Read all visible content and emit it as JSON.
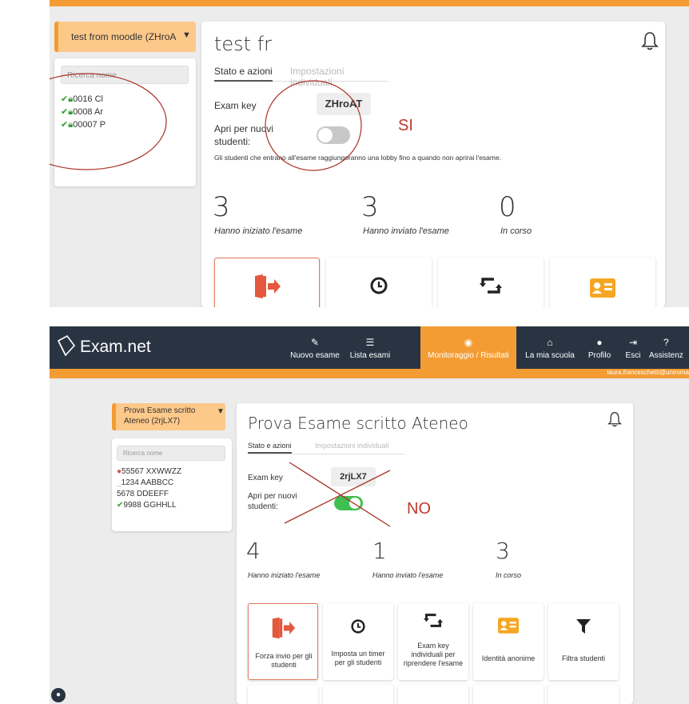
{
  "top": {
    "exam_dropdown": "test from moodle (ZHroA",
    "search_placeholder": "Ricerca nome",
    "students": [
      {
        "id": "0016 Cl",
        "status": "ok"
      },
      {
        "id": "0008 Ar",
        "status": "ok"
      },
      {
        "id": "00007 P",
        "status": "ok"
      }
    ],
    "title": "test fr",
    "tab_status": "Stato e azioni",
    "tab_settings": "Impostazioni individuali",
    "exam_key_label": "Exam key",
    "exam_key": "ZHroAT",
    "open_label": "Apri per nuovi studenti:",
    "lobby_note": "Gli studenti che entrano all'esame raggiungeranno una lobby fino a quando non aprirai l'esame.",
    "stats": [
      {
        "value": "3",
        "label": "Hanno iniziato l'esame"
      },
      {
        "value": "3",
        "label": "Hanno inviato l'esame"
      },
      {
        "value": "0",
        "label": "In corso"
      }
    ],
    "annotation": "SI",
    "toggle_on": false
  },
  "bottom": {
    "brand": "Exam.net",
    "nav": [
      {
        "icon": "pencil-icon",
        "label": "Nuovo esame"
      },
      {
        "icon": "list-icon",
        "label": "Lista esami"
      },
      {
        "icon": "eye-icon",
        "label": "Monitoraggio / Risultati"
      },
      {
        "icon": "home-icon",
        "label": "La mia scuola"
      },
      {
        "icon": "user-icon",
        "label": "Profilo"
      },
      {
        "icon": "sign-out-icon",
        "label": "Esci"
      },
      {
        "icon": "help-icon",
        "label": "Assistenz"
      }
    ],
    "user_email": "laura.franceschetti@uniroma",
    "exam_dropdown": "Prova Esame scritto Ateneo (2rjLX7)",
    "search_placeholder": "Ricerca nome",
    "students": [
      {
        "id": "55567 XXWWZZ",
        "status": "error"
      },
      {
        "id": "1234 AABBCC",
        "status": "none"
      },
      {
        "id": "5678 DDEEFF",
        "status": "none"
      },
      {
        "id": "9988 GGHHLL",
        "status": "ok"
      }
    ],
    "title": "Prova Esame scritto Ateneo",
    "tab_status": "Stato e azioni",
    "tab_settings": "Impostazioni individuali",
    "exam_key_label": "Exam key",
    "exam_key": "2rjLX7",
    "open_label": "Apri per nuovi studenti:",
    "stats": [
      {
        "value": "4",
        "label": "Hanno iniziato l'esame"
      },
      {
        "value": "1",
        "label": "Hanno inviato l'esame"
      },
      {
        "value": "3",
        "label": "In corso"
      }
    ],
    "tiles": [
      {
        "icon": "force-submit-icon",
        "label": "Forza invio per gli studenti"
      },
      {
        "icon": "clock-icon",
        "label": "Imposta un timer per gli studenti"
      },
      {
        "icon": "retweet-icon",
        "label": "Exam key individuali per riprendere l'esame"
      },
      {
        "icon": "id-card-icon",
        "label": "Identità anonime"
      },
      {
        "icon": "filter-icon",
        "label": "Filtra studenti"
      }
    ],
    "annotation": "NO",
    "toggle_on": true
  }
}
